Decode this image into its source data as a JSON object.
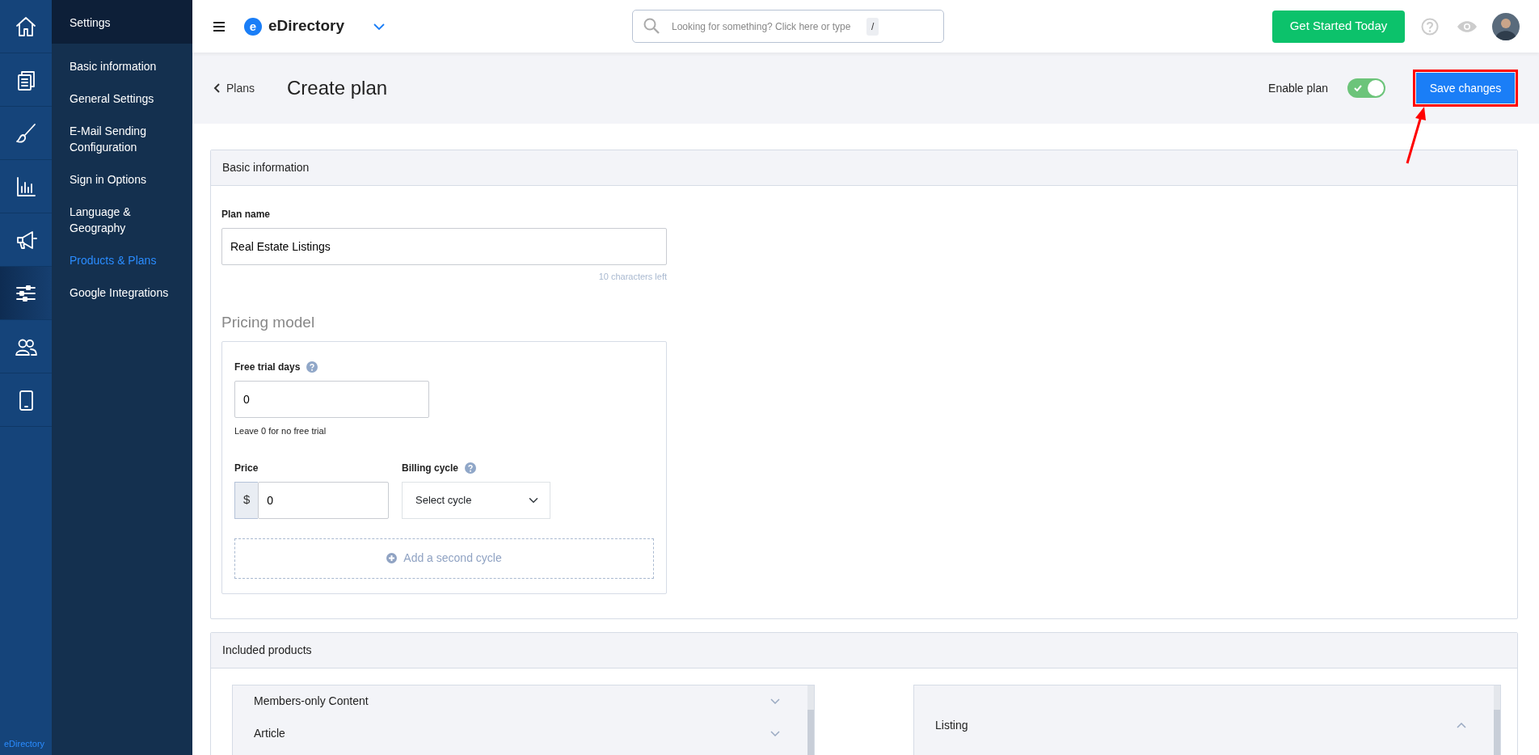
{
  "icon_rail": {
    "items": [
      {
        "selected": false
      },
      {
        "selected": false
      },
      {
        "selected": false
      },
      {
        "selected": false
      },
      {
        "selected": false
      },
      {
        "selected": true
      },
      {
        "selected": false
      },
      {
        "selected": false
      }
    ],
    "footer": "eDirectory"
  },
  "sidebar": {
    "title": "Settings",
    "items": [
      {
        "label": "Basic information",
        "selected": false
      },
      {
        "label": "General Settings",
        "selected": false
      },
      {
        "label": "E-Mail Sending Configuration",
        "selected": false
      },
      {
        "label": "Sign in Options",
        "selected": false
      },
      {
        "label": "Language & Geography",
        "selected": false
      },
      {
        "label": "Products & Plans",
        "selected": true
      },
      {
        "label": "Google Integrations",
        "selected": false
      }
    ]
  },
  "topbar": {
    "logo": "eDirectory",
    "logo_letter": "e",
    "search": {
      "placeholder": "Looking for something? Click here or type",
      "shortcut": "/"
    },
    "cta": "Get Started Today"
  },
  "header": {
    "back": "Plans",
    "title": "Create plan",
    "enable_plan": {
      "label": "Enable plan",
      "on": true
    },
    "save": "Save changes"
  },
  "basic_information": {
    "title": "Basic information",
    "plan_name": {
      "label": "Plan name",
      "value": "Real Estate Listings",
      "hint": "10 characters left"
    },
    "pricing": {
      "title": "Pricing model",
      "free_trial": {
        "label": "Free trial days",
        "value": "0",
        "help": "Leave 0 for no free trial"
      },
      "price": {
        "label": "Price",
        "prefix": "$",
        "value": "0"
      },
      "billing_cycle": {
        "label": "Billing cycle",
        "value": "Select cycle"
      },
      "add_cycle": "Add a second cycle"
    }
  },
  "included_products": {
    "title": "Included products",
    "left": [
      {
        "label": "Members-only Content",
        "expanded": false
      },
      {
        "label": "Article",
        "expanded": false
      }
    ],
    "right": [
      {
        "label": "Listing",
        "expanded": true
      }
    ]
  }
}
